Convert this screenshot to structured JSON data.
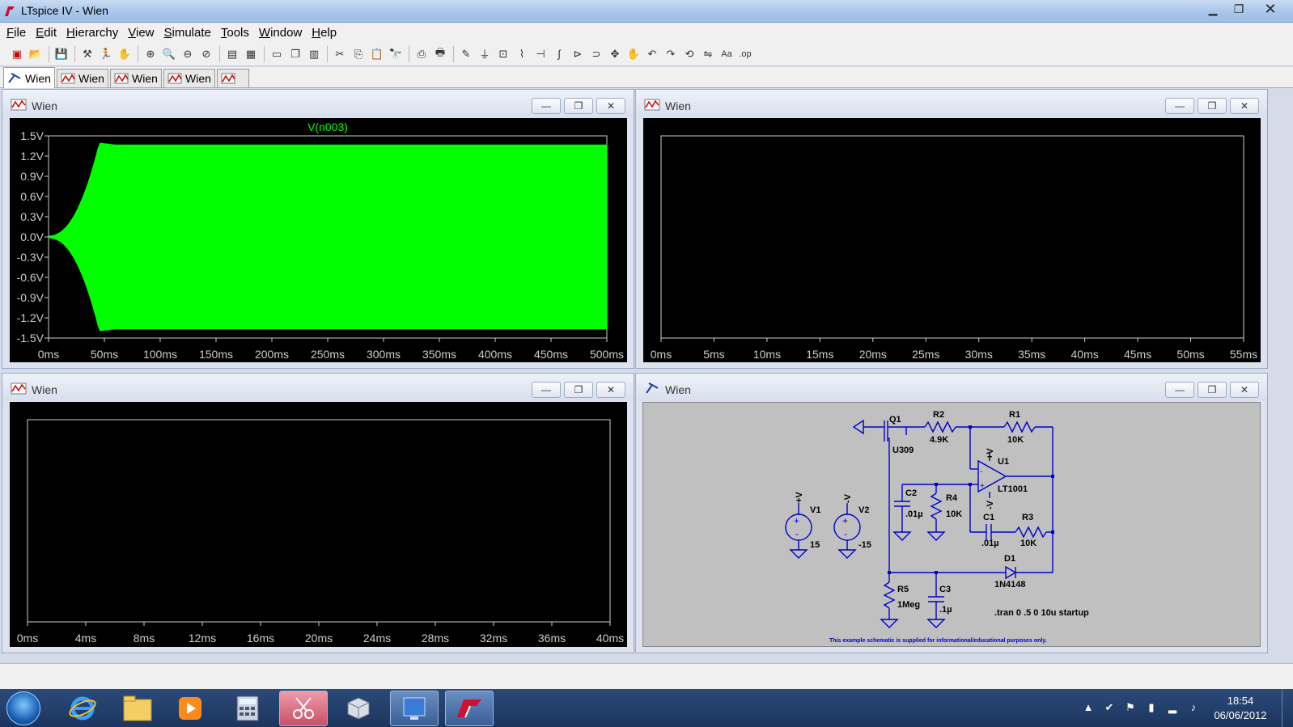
{
  "window": {
    "title": "LTspice IV - Wien"
  },
  "menu": [
    {
      "label": "File",
      "ul": "F"
    },
    {
      "label": "Edit",
      "ul": "E"
    },
    {
      "label": "Hierarchy",
      "ul": "H"
    },
    {
      "label": "View",
      "ul": "V"
    },
    {
      "label": "Simulate",
      "ul": "S"
    },
    {
      "label": "Tools",
      "ul": "T"
    },
    {
      "label": "Window",
      "ul": "W"
    },
    {
      "label": "Help",
      "ul": "H"
    }
  ],
  "tabs": [
    {
      "label": "Wien",
      "kind": "schematic",
      "active": true
    },
    {
      "label": "Wien",
      "kind": "plot"
    },
    {
      "label": "Wien",
      "kind": "plot"
    },
    {
      "label": "Wien",
      "kind": "plot"
    },
    {
      "label": "",
      "kind": "plot"
    }
  ],
  "windows": {
    "plot1": {
      "title": "Wien",
      "trace_label": "V(n003)",
      "trace_color": "#00ff00",
      "y_ticks": [
        "1.5V",
        "1.2V",
        "0.9V",
        "0.6V",
        "0.3V",
        "0.0V",
        "-0.3V",
        "-0.6V",
        "-0.9V",
        "-1.2V",
        "-1.5V"
      ],
      "x_ticks": [
        "0ms",
        "50ms",
        "100ms",
        "150ms",
        "200ms",
        "250ms",
        "300ms",
        "350ms",
        "400ms",
        "450ms",
        "500ms"
      ]
    },
    "plot2": {
      "title": "Wien",
      "x_ticks": [
        "0ms",
        "5ms",
        "10ms",
        "15ms",
        "20ms",
        "25ms",
        "30ms",
        "35ms",
        "40ms",
        "45ms",
        "50ms",
        "55ms"
      ]
    },
    "plot3": {
      "title": "Wien",
      "x_ticks": [
        "0ms",
        "4ms",
        "8ms",
        "12ms",
        "16ms",
        "20ms",
        "24ms",
        "28ms",
        "32ms",
        "36ms",
        "40ms"
      ]
    },
    "schematic": {
      "title": "Wien",
      "labels": {
        "q1": "Q1",
        "q1_model": "U309",
        "r2": "R2",
        "r2_val": "4.9K",
        "r1": "R1",
        "r1_val": "10K",
        "u1": "U1",
        "u1_model": "LT1001",
        "c2": "C2",
        "c2_val": ".01µ",
        "r4": "R4",
        "r4_val": "10K",
        "c1": "C1",
        "c1_val": ".01µ",
        "r3": "R3",
        "r3_val": "10K",
        "d1": "D1",
        "d1_model": "1N4148",
        "r5": "R5",
        "r5_val": "1Meg",
        "c3": "C3",
        "c3_val": ".1µ",
        "v1": "V1",
        "v1_val": "15",
        "v2": "V2",
        "v2_val": "-15",
        "vplus": "+V",
        "vminus": "-V",
        "tran": ".tran 0 .5 0 10u startup",
        "footer": "This example schematic is supplied for informational/educational purposes only."
      }
    }
  },
  "child_buttons": {
    "minimize": "—",
    "restore": "❐",
    "close": "✕"
  },
  "taskbar": {
    "time": "18:54",
    "date": "06/06/2012"
  }
}
